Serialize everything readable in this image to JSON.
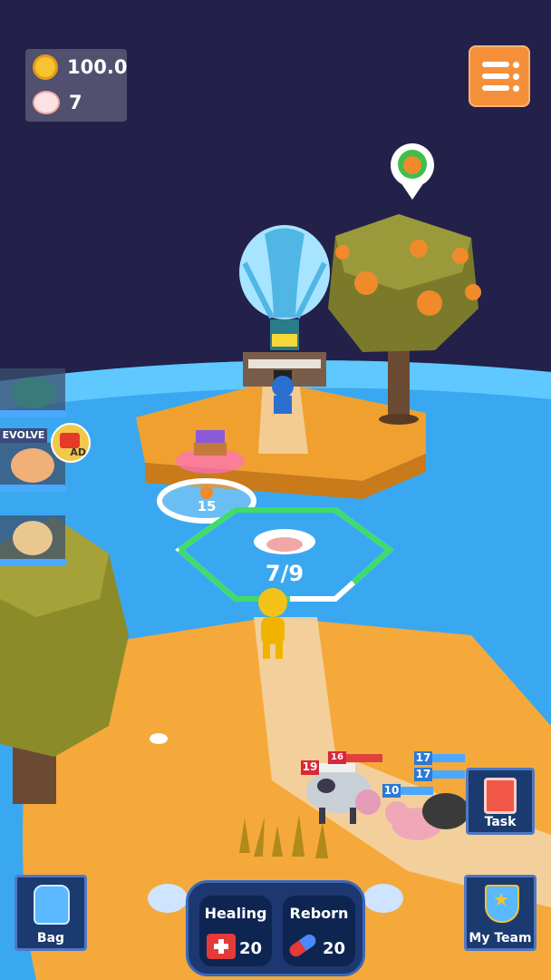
{
  "hud": {
    "coins_value": "100.0(",
    "paws_value": "7"
  },
  "pets_sidebar": {
    "evolve_label": "EVOLVE",
    "ad_label": "AD"
  },
  "map": {
    "node_cost": "15",
    "hex_progress": "7/9"
  },
  "enemies": {
    "hp_red_1": "19",
    "hp_red_2": "16",
    "hp_blue_1": "17",
    "hp_blue_2": "17",
    "hp_blue_3": "10"
  },
  "buttons": {
    "task_label": "Task",
    "bag_label": "Bag",
    "my_team_label": "My Team",
    "healing_label": "Healing",
    "healing_count": "20",
    "reborn_label": "Reborn",
    "reborn_count": "20"
  },
  "colors": {
    "sky": "#23204a",
    "water": "#3aa8f0",
    "island": "#f5a93a",
    "accent_orange": "#f5903a",
    "panel_blue": "#1d3770",
    "hex_outline": "#3fdc6a"
  }
}
